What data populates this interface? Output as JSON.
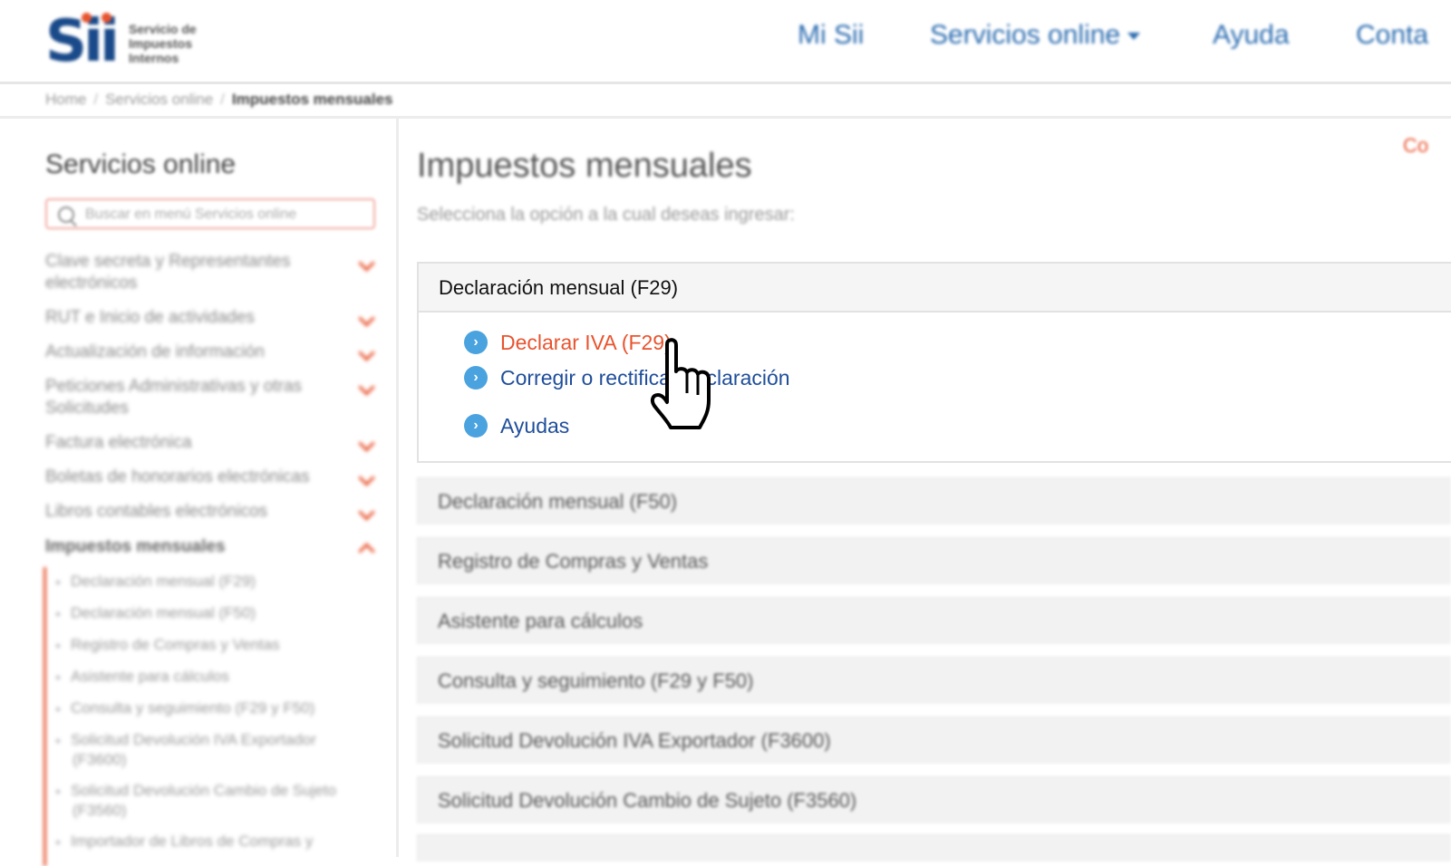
{
  "header": {
    "logo": {
      "mark": "Sii",
      "line1": "Servicio de",
      "line2": "Impuestos",
      "line3": "Internos"
    },
    "nav": [
      {
        "label": "Mi Sii"
      },
      {
        "label": "Servicios online"
      },
      {
        "label": "Ayuda"
      },
      {
        "label": "Conta"
      }
    ]
  },
  "breadcrumb": {
    "items": [
      "Home",
      "Servicios online"
    ],
    "current": "Impuestos mensuales"
  },
  "sidebar": {
    "title": "Servicios online",
    "search_placeholder": "Buscar en menú Servicios online",
    "items": [
      {
        "label": "Clave secreta y Representantes electrónicos"
      },
      {
        "label": "RUT e Inicio de actividades"
      },
      {
        "label": "Actualización de información"
      },
      {
        "label": "Peticiones Administrativas y otras Solicitudes"
      },
      {
        "label": "Factura electrónica"
      },
      {
        "label": "Boletas de honorarios electrónicas"
      },
      {
        "label": "Libros contables electrónicos"
      },
      {
        "label": "Impuestos mensuales"
      }
    ],
    "subitems": [
      {
        "label": "Declaración mensual (F29)"
      },
      {
        "label": "Declaración mensual (F50)"
      },
      {
        "label": "Registro de Compras y Ventas"
      },
      {
        "label": "Asistente para cálculos"
      },
      {
        "label": "Consulta y seguimiento (F29 y F50)"
      },
      {
        "label": "Solicitud Devolución IVA Exportador (F3600)"
      },
      {
        "label": "Solicitud Devolución Cambio de Sujeto (F3560)"
      },
      {
        "label": "Importador de Libros de Compras y"
      }
    ]
  },
  "main": {
    "title": "Impuestos mensuales",
    "subtitle": "Selecciona la opción a la cual deseas ingresar:",
    "corner_text": "Co",
    "panel": {
      "title": "Declaración mensual (F29)",
      "options": [
        {
          "label": "Declarar IVA (F29)",
          "icon": "chevron-right-icon"
        },
        {
          "label": "Corregir o rectificar declaración",
          "icon": "chevron-right-icon"
        },
        {
          "label": "Ayudas",
          "icon": "chevron-right-icon"
        }
      ]
    },
    "accordion": [
      {
        "label": "Declaración mensual (F50)"
      },
      {
        "label": "Registro de Compras y Ventas"
      },
      {
        "label": "Asistente para cálculos"
      },
      {
        "label": "Consulta y seguimiento (F29 y F50)"
      },
      {
        "label": "Solicitud Devolución IVA Exportador (F3600)"
      },
      {
        "label": "Solicitud Devolución Cambio de Sujeto (F3560)"
      }
    ]
  },
  "colors": {
    "brand_blue": "#1a4a8a",
    "link_blue": "#1f4e9a",
    "accent_orange": "#e8542f",
    "icon_blue": "#4aa3df"
  },
  "cursor": {
    "icon": "hand-pointer-icon"
  }
}
